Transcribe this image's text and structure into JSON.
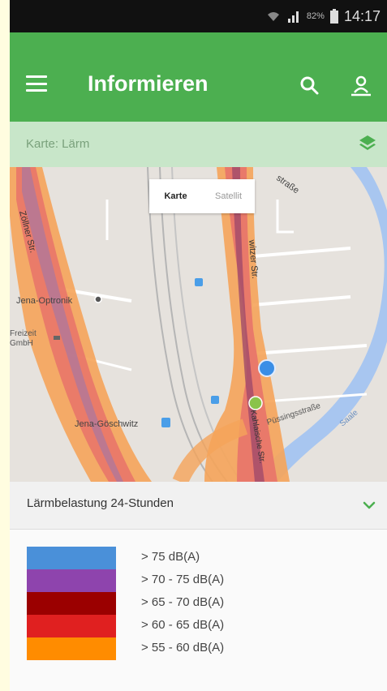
{
  "status_bar": {
    "battery": "82%",
    "time": "14:17"
  },
  "app_bar": {
    "title": "Informieren"
  },
  "subbar": {
    "map_label": "Karte: Lärm"
  },
  "map": {
    "toggle": {
      "map": "Karte",
      "satellite": "Satellit"
    },
    "labels": {
      "strasse_top": "straße",
      "witzer_str": "witzer Str.",
      "left_str": "Zöllner Str.",
      "optronik": "Jena-Optronik",
      "freizeit_line1": "Freizeit",
      "freizeit_line2": "GmbH",
      "goschwitz": "Jena-Göschwitz",
      "pussing": "Püssingsstraße",
      "saale": "Saale",
      "bottom_str": "Kahlaische Str."
    }
  },
  "panel": {
    "title": "Lärmbelastung 24-Stunden"
  },
  "legend": [
    {
      "label": "> 75 dB(A)",
      "color": "#4a90d9"
    },
    {
      "label": "> 70 - 75 dB(A)",
      "color": "#8e44ad"
    },
    {
      "label": "> 65 - 70 dB(A)",
      "color": "#9b0000"
    },
    {
      "label": "> 60 - 65 dB(A)",
      "color": "#e02020"
    },
    {
      "label": "> 55 - 60 dB(A)",
      "color": "#ff8c00"
    }
  ],
  "colors": {
    "accent": "#4caf50",
    "subbar": "#c8e6c9",
    "status_bar": "#111111"
  },
  "icons": {
    "menu": "menu-icon",
    "search": "search-icon",
    "user": "user-location-icon",
    "layers": "layers-icon",
    "chevron": "chevron-down-icon"
  }
}
